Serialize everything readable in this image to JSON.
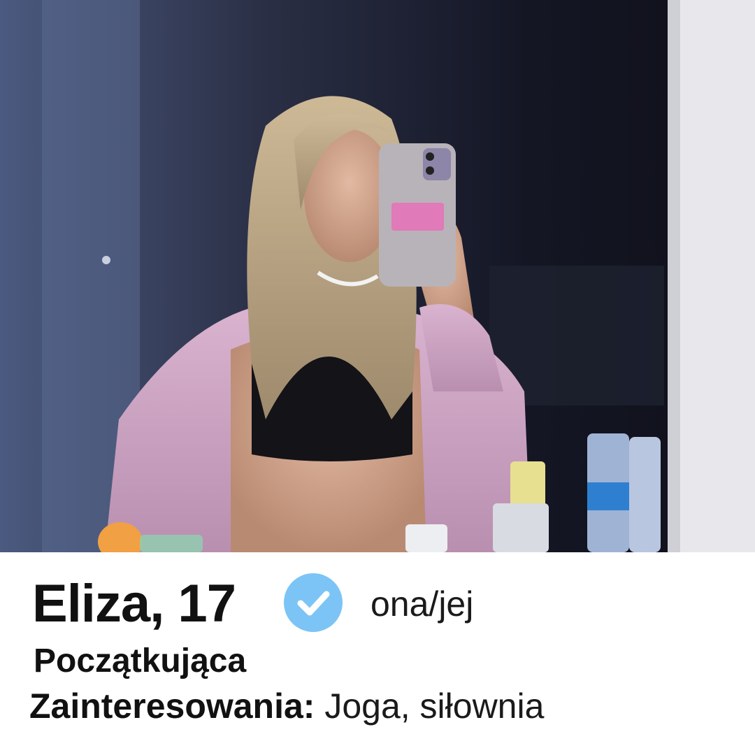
{
  "profile": {
    "name_age": "Eliza, 17",
    "pronouns": "ona/jej",
    "level": "Początkująca",
    "interests_label": "Zainteresowania:",
    "interests_value": " Joga, siłownia",
    "verified_icon": "verified-check-icon"
  },
  "colors": {
    "verified_badge": "#7cc4f5",
    "text": "#111111",
    "background": "#ffffff"
  }
}
